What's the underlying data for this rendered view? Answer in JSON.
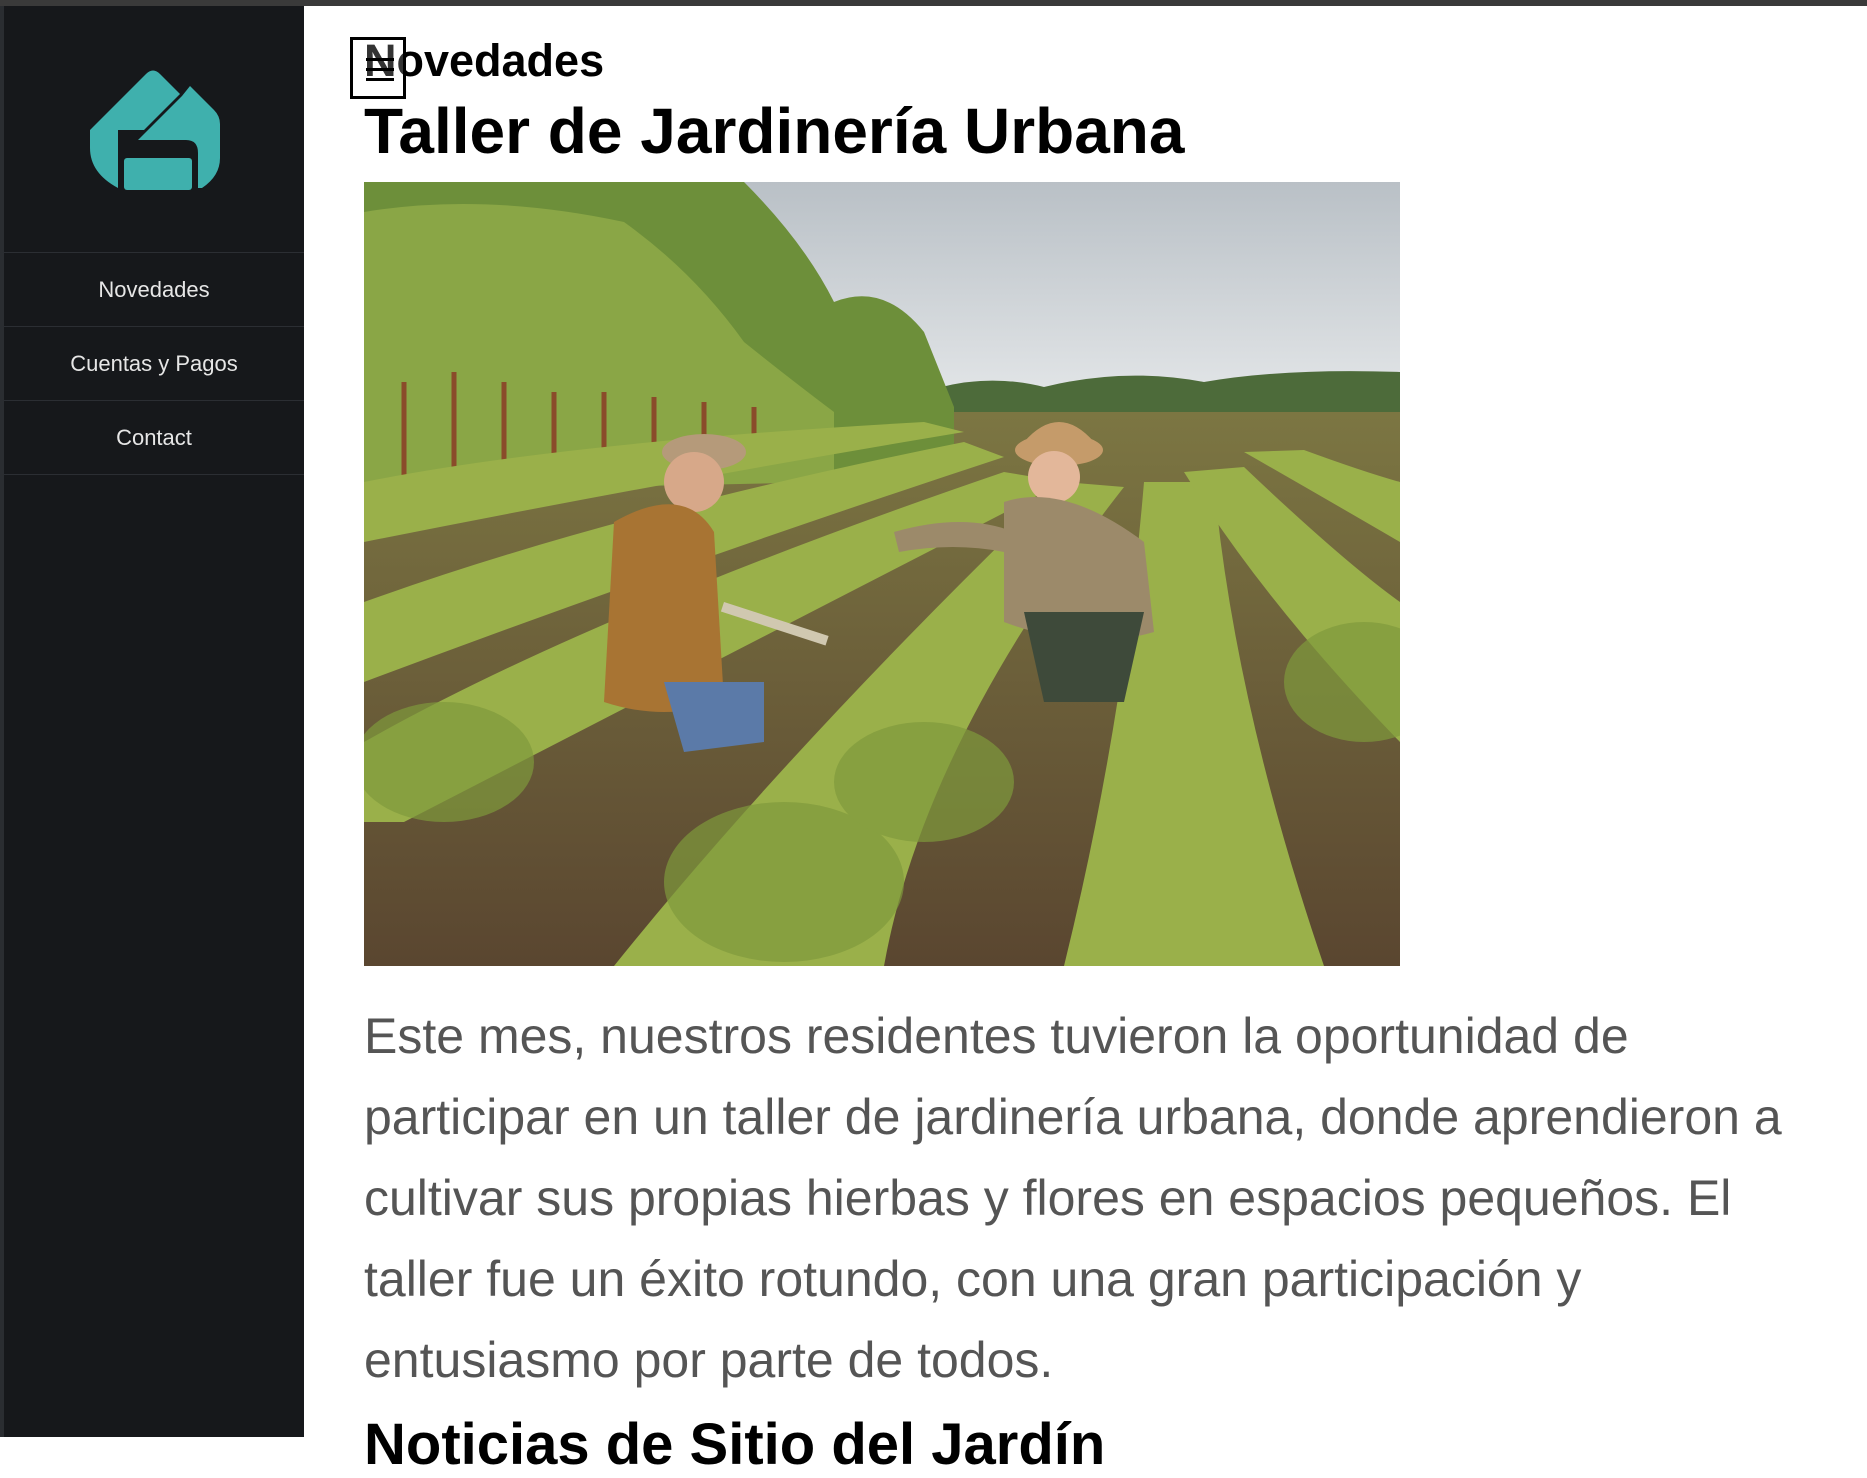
{
  "sidebar": {
    "logo_icon": "house-logo-icon",
    "brand_color": "#3fb0ad",
    "items": [
      {
        "label": "Novedades"
      },
      {
        "label": "Cuentas y Pagos"
      },
      {
        "label": "Contact"
      }
    ]
  },
  "main": {
    "section_heading": "Novedades",
    "menu_icon": "hamburger-menu-icon",
    "article": {
      "title": "Taller de Jardinería Urbana",
      "image": "photo-two-people-tending-plant-rows-in-field",
      "body": "Este mes, nuestros residentes tuvieron la oportunidad de participar en un taller de jardinería urbana, donde aprendieron a cultivar sus propias hierbas y flores en espacios pequeños. El taller fue un éxito rotundo, con una gran participación y entusiasmo por parte de todos."
    },
    "next_article_title": "Noticias de Sitio del Jardín"
  }
}
